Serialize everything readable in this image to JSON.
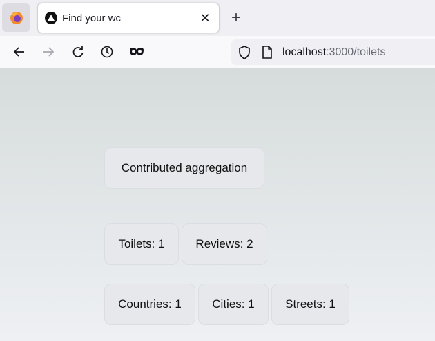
{
  "browser": {
    "tab": {
      "title": "Find your wc"
    },
    "url": {
      "host": "localhost",
      "path": ":3000/toilets"
    }
  },
  "content": {
    "title_card": "Contributed aggregation",
    "stats_row1": [
      "Toilets: 1",
      "Reviews: 2"
    ],
    "stats_row2": [
      "Countries: 1",
      "Cities: 1",
      "Streets: 1"
    ]
  }
}
